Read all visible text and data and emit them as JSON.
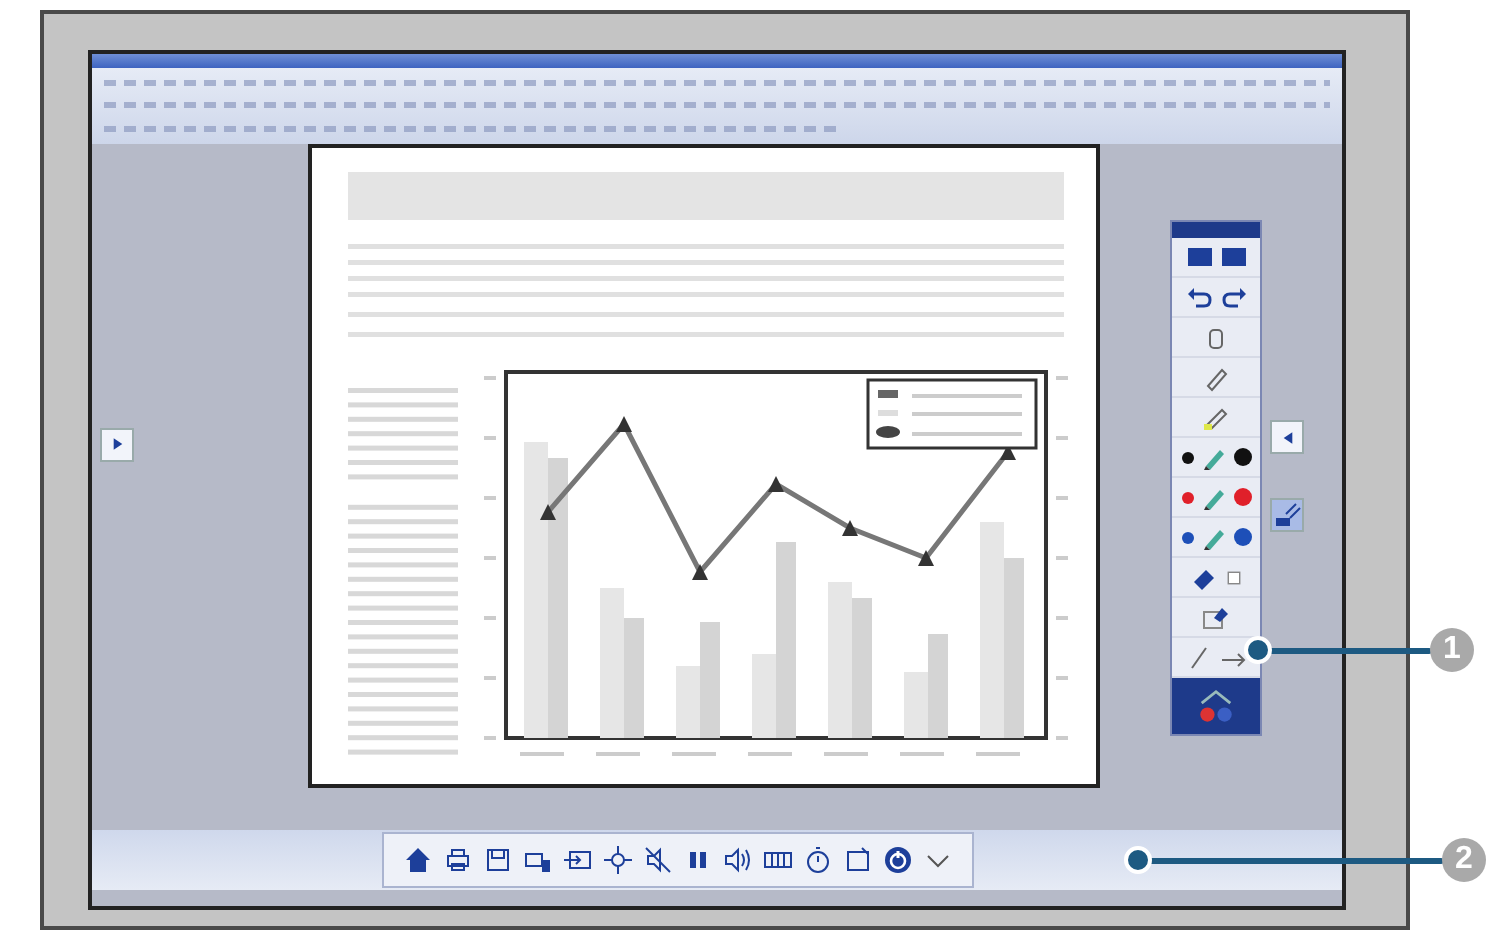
{
  "pens": [
    {
      "color": "#111111"
    },
    {
      "color": "#e0202a"
    },
    {
      "color": "#1d4fb8"
    }
  ],
  "callouts": [
    {
      "label": "1"
    },
    {
      "label": "2"
    }
  ]
}
